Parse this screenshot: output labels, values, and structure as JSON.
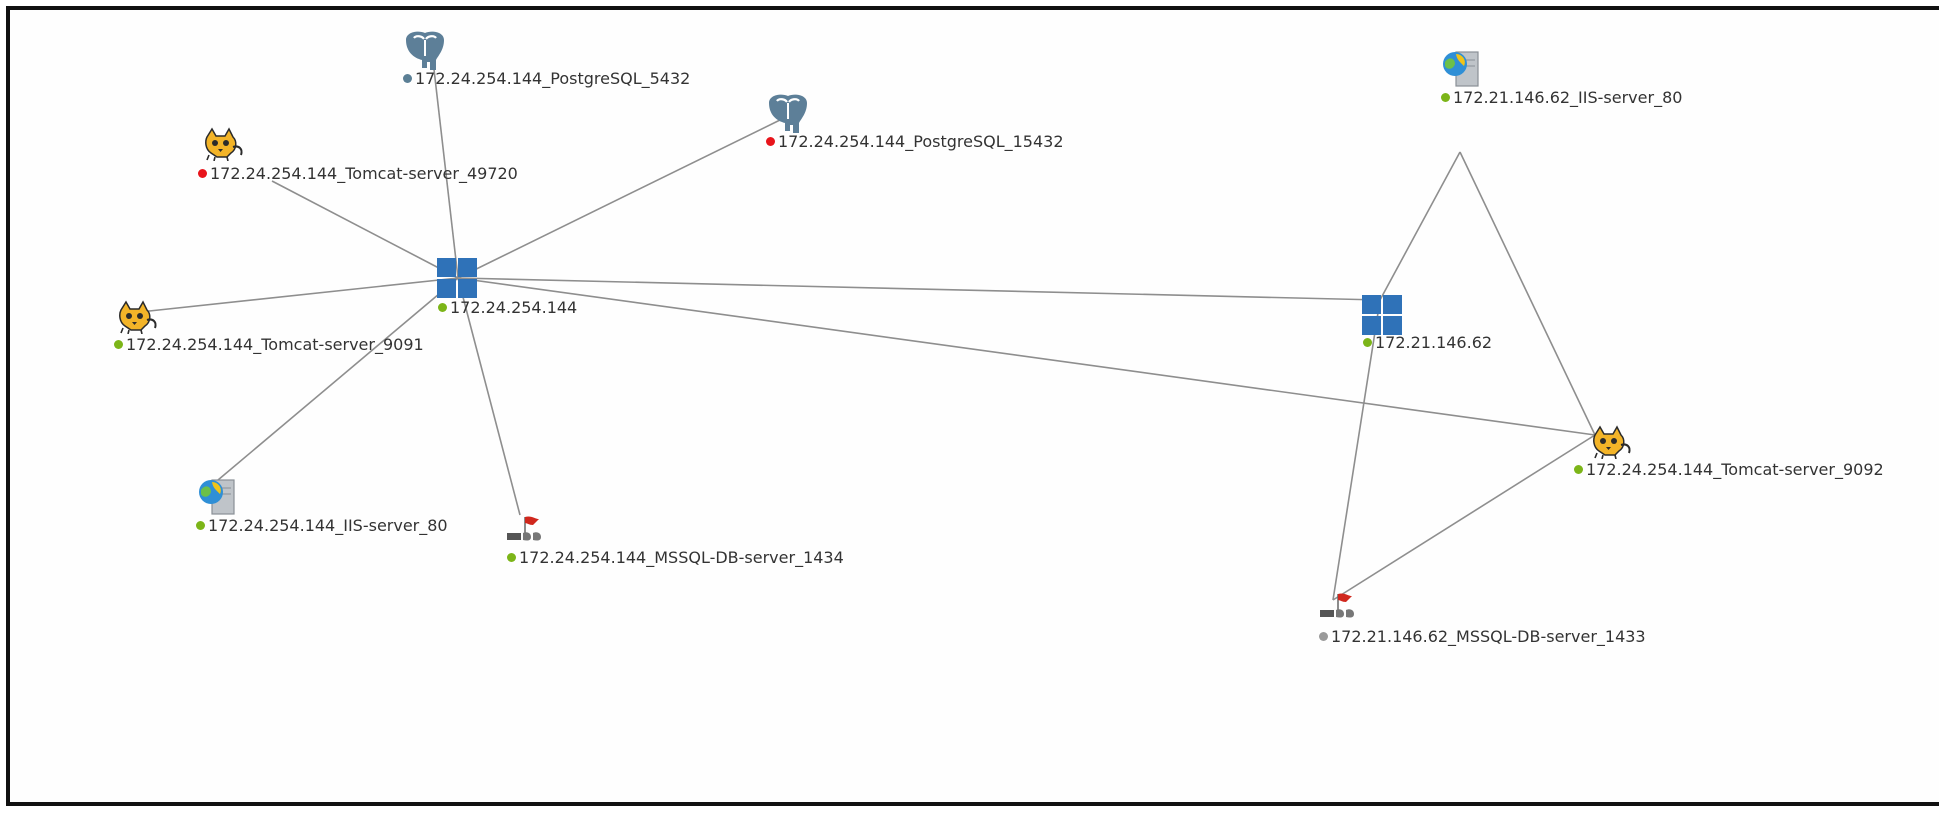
{
  "colors": {
    "ok": "#7cb518",
    "error": "#e8141b",
    "neutral": "#9a9a9a",
    "postgres-status": "#5b7f95",
    "host": "#2f72b8"
  },
  "nodes": {
    "pg5432": {
      "label": "172.24.254.144_PostgreSQL_5432",
      "status": "postgres-status",
      "icon": "postgresql-elephant-icon"
    },
    "pg15432": {
      "label": "172.24.254.144_PostgreSQL_15432",
      "status": "error",
      "icon": "postgresql-elephant-icon"
    },
    "tc49720": {
      "label": "172.24.254.144_Tomcat-server_49720",
      "status": "error",
      "icon": "tomcat-cat-icon"
    },
    "host144": {
      "label": "172.24.254.144",
      "status": "ok",
      "icon": "windows-host-icon"
    },
    "tc9091": {
      "label": "172.24.254.144_Tomcat-server_9091",
      "status": "ok",
      "icon": "tomcat-cat-icon"
    },
    "iis144": {
      "label": "172.24.254.144_IIS-server_80",
      "status": "ok",
      "icon": "iis-server-icon"
    },
    "mssql1434": {
      "label": "172.24.254.144_MSSQL-DB-server_1434",
      "status": "ok",
      "icon": "mssql-server-icon"
    },
    "iis62": {
      "label": "172.21.146.62_IIS-server_80",
      "status": "ok",
      "icon": "iis-server-icon"
    },
    "host62": {
      "label": "172.21.146.62",
      "status": "ok",
      "icon": "windows-host-icon"
    },
    "tc9092": {
      "label": "172.24.254.144_Tomcat-server_9092",
      "status": "ok",
      "icon": "tomcat-cat-icon"
    },
    "mssql1433": {
      "label": "172.21.146.62_MSSQL-DB-server_1433",
      "status": "neutral",
      "icon": "mssql-server-icon"
    }
  },
  "edges": [
    [
      "host144",
      "pg5432"
    ],
    [
      "host144",
      "pg15432"
    ],
    [
      "host144",
      "tc49720"
    ],
    [
      "host144",
      "tc9091"
    ],
    [
      "host144",
      "iis144"
    ],
    [
      "host144",
      "mssql1434"
    ],
    [
      "host144",
      "host62"
    ],
    [
      "host144",
      "tc9092"
    ],
    [
      "host62",
      "iis62"
    ],
    [
      "host62",
      "mssql1433"
    ],
    [
      "iis62",
      "tc9092"
    ],
    [
      "tc9092",
      "mssql1433"
    ]
  ]
}
